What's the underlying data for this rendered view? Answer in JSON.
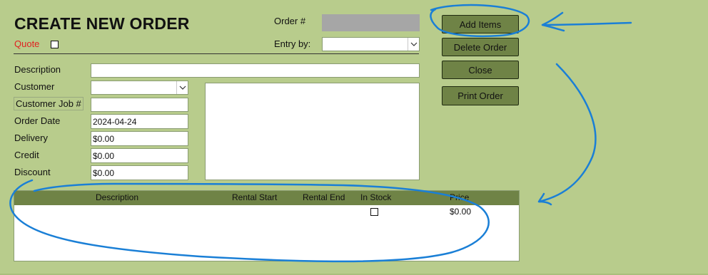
{
  "form": {
    "title": "CREATE NEW ORDER",
    "quote_label": "Quote",
    "quote_checked": false,
    "order_no_label": "Order #",
    "order_no_value": "",
    "entry_by_label": "Entry by:",
    "entry_by_value": ""
  },
  "fields": {
    "description": {
      "label": "Description",
      "value": ""
    },
    "customer": {
      "label": "Customer",
      "value": ""
    },
    "customer_job": {
      "label": "Customer Job #",
      "value": ""
    },
    "order_date": {
      "label": "Order Date",
      "value": "2024-04-24"
    },
    "delivery": {
      "label": "Delivery",
      "value": "$0.00"
    },
    "credit": {
      "label": "Credit",
      "value": "$0.00"
    },
    "discount": {
      "label": "Discount",
      "value": "$0.00"
    },
    "notes": {
      "value": ""
    }
  },
  "buttons": {
    "add_items": "Add Items",
    "delete_order": "Delete Order",
    "close": "Close",
    "print_order": "Print Order"
  },
  "items_grid": {
    "columns": [
      "Description",
      "Rental Start",
      "Rental End",
      "In Stock",
      "Price"
    ],
    "rows": [
      {
        "description": "",
        "rental_start": "",
        "rental_end": "",
        "in_stock": false,
        "price": "$0.00"
      }
    ]
  },
  "colors": {
    "background": "#b8cc8c",
    "button": "#6f8346",
    "grid_header": "#6f8346",
    "quote_text": "#e02020",
    "annotation": "#1a7fd6"
  },
  "icons": {
    "dropdown": "chevron-down-icon",
    "annotation_arrow": "arrow-icon"
  }
}
